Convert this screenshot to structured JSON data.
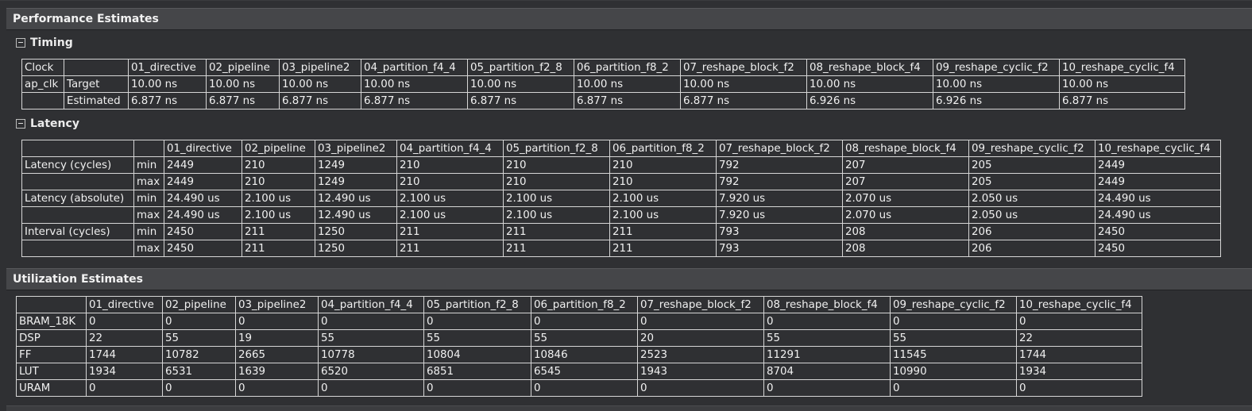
{
  "performance_title": "Performance Estimates",
  "timing": {
    "title": "Timing",
    "headers": [
      "Clock",
      "",
      "01_directive",
      "02_pipeline",
      "03_pipeline2",
      "04_partition_f4_4",
      "05_partition_f2_8",
      "06_partition_f8_2",
      "07_reshape_block_f2",
      "08_reshape_block_f4",
      "09_reshape_cyclic_f2",
      "10_reshape_cyclic_f4"
    ],
    "rows": [
      [
        "ap_clk",
        "Target",
        "10.00 ns",
        "10.00 ns",
        "10.00 ns",
        "10.00 ns",
        "10.00 ns",
        "10.00 ns",
        "10.00 ns",
        "10.00 ns",
        "10.00 ns",
        "10.00 ns"
      ],
      [
        "",
        "Estimated",
        "6.877 ns",
        "6.877 ns",
        "6.877 ns",
        "6.877 ns",
        "6.877 ns",
        "6.877 ns",
        "6.877 ns",
        "6.926 ns",
        "6.926 ns",
        "6.877 ns"
      ]
    ]
  },
  "latency": {
    "title": "Latency",
    "headers": [
      "",
      "",
      "01_directive",
      "02_pipeline",
      "03_pipeline2",
      "04_partition_f4_4",
      "05_partition_f2_8",
      "06_partition_f8_2",
      "07_reshape_block_f2",
      "08_reshape_block_f4",
      "09_reshape_cyclic_f2",
      "10_reshape_cyclic_f4"
    ],
    "rows": [
      [
        "Latency (cycles)",
        "min",
        "2449",
        "210",
        "1249",
        "210",
        "210",
        "210",
        "792",
        "207",
        "205",
        "2449"
      ],
      [
        "",
        "max",
        "2449",
        "210",
        "1249",
        "210",
        "210",
        "210",
        "792",
        "207",
        "205",
        "2449"
      ],
      [
        "Latency (absolute)",
        "min",
        "24.490 us",
        "2.100 us",
        "12.490 us",
        "2.100 us",
        "2.100 us",
        "2.100 us",
        "7.920 us",
        "2.070 us",
        "2.050 us",
        "24.490 us"
      ],
      [
        "",
        "max",
        "24.490 us",
        "2.100 us",
        "12.490 us",
        "2.100 us",
        "2.100 us",
        "2.100 us",
        "7.920 us",
        "2.070 us",
        "2.050 us",
        "24.490 us"
      ],
      [
        "Interval (cycles)",
        "min",
        "2450",
        "211",
        "1250",
        "211",
        "211",
        "211",
        "793",
        "208",
        "206",
        "2450"
      ],
      [
        "",
        "max",
        "2450",
        "211",
        "1250",
        "211",
        "211",
        "211",
        "793",
        "208",
        "206",
        "2450"
      ]
    ]
  },
  "utilization_title": "Utilization Estimates",
  "utilization": {
    "headers": [
      "",
      "01_directive",
      "02_pipeline",
      "03_pipeline2",
      "04_partition_f4_4",
      "05_partition_f2_8",
      "06_partition_f8_2",
      "07_reshape_block_f2",
      "08_reshape_block_f4",
      "09_reshape_cyclic_f2",
      "10_reshape_cyclic_f4"
    ],
    "rows": [
      [
        "BRAM_18K",
        "0",
        "0",
        "0",
        "0",
        "0",
        "0",
        "0",
        "0",
        "0",
        "0"
      ],
      [
        "DSP",
        "22",
        "55",
        "19",
        "55",
        "55",
        "55",
        "20",
        "55",
        "55",
        "22"
      ],
      [
        "FF",
        "1744",
        "10782",
        "2665",
        "10778",
        "10804",
        "10846",
        "2523",
        "11291",
        "11545",
        "1744"
      ],
      [
        "LUT",
        "1934",
        "6531",
        "1639",
        "6520",
        "6851",
        "6545",
        "1943",
        "8704",
        "10990",
        "1934"
      ],
      [
        "URAM",
        "0",
        "0",
        "0",
        "0",
        "0",
        "0",
        "0",
        "0",
        "0",
        "0"
      ]
    ]
  }
}
